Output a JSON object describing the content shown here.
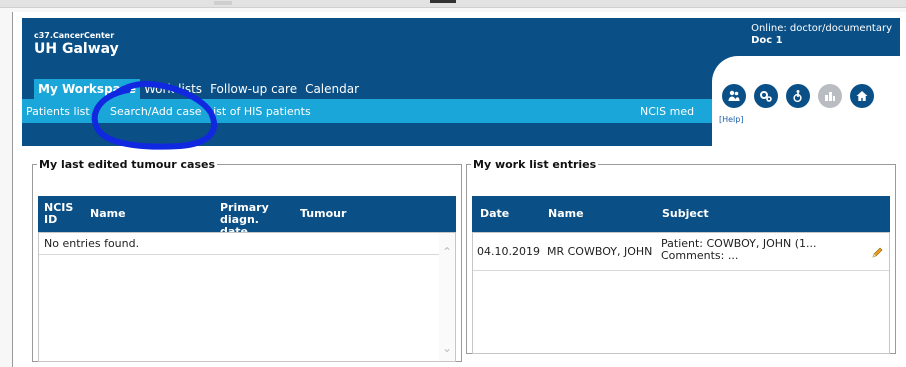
{
  "app": {
    "brand_small": "c37.CancerCenter",
    "brand_big": "UH Galway"
  },
  "user": {
    "online": "Online: doctor/documentary",
    "doc": "Doc 1"
  },
  "nav_primary": {
    "my_workspace": "My Workspace",
    "work_lists": "Work lists",
    "follow_up": "Follow-up care",
    "calendar": "Calendar"
  },
  "nav_secondary": {
    "patients_list": "Patients list",
    "search_add_case": "Search/Add case",
    "his_patients": "List of HIS patients",
    "ncis_med": "NCIS med"
  },
  "icons": [
    "patient-icon",
    "settings-icon",
    "accessibility-icon",
    "reports-icon",
    "home-icon"
  ],
  "help_label": "[Help]",
  "tumour_cases": {
    "title": "My last edited tumour cases",
    "columns": [
      "NCIS ID",
      "Name",
      "Primary diagn. date",
      "Tumour"
    ],
    "empty": "No entries found."
  },
  "work_list": {
    "title": "My work list entries",
    "columns": [
      "Date",
      "Name",
      "Subject"
    ],
    "rows": [
      {
        "date": "04.10.2019",
        "name": "MR COWBOY, JOHN",
        "subject_patient": "Patient: COWBOY, JOHN (1...",
        "subject_comments": "Comments:  ..."
      }
    ]
  },
  "colors": {
    "header_blue": "#0a4f86",
    "nav_cyan": "#1aa6d8",
    "annotation_blue": "#1029e0"
  }
}
